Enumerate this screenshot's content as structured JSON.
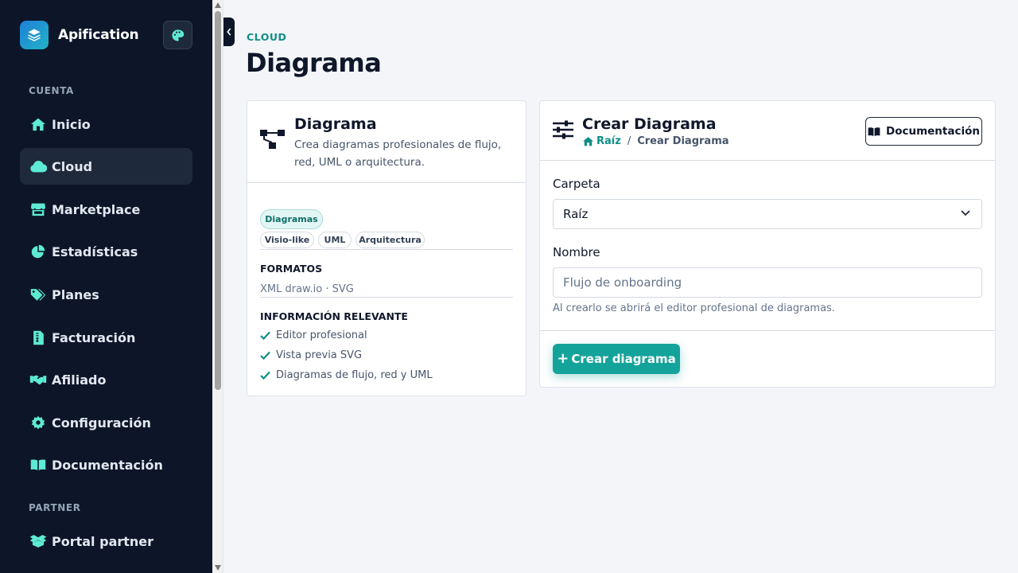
{
  "app": {
    "name": "Apification"
  },
  "sidebar": {
    "sections": {
      "cuenta": "CUENTA",
      "partner": "PARTNER"
    },
    "items": [
      {
        "label": "Inicio",
        "icon": "home-icon"
      },
      {
        "label": "Cloud",
        "icon": "cloud-icon",
        "active": true
      },
      {
        "label": "Marketplace",
        "icon": "store-icon"
      },
      {
        "label": "Estadísticas",
        "icon": "pie-chart-icon"
      },
      {
        "label": "Planes",
        "icon": "tags-icon"
      },
      {
        "label": "Facturación",
        "icon": "invoice-icon"
      },
      {
        "label": "Afiliado",
        "icon": "handshake-icon"
      },
      {
        "label": "Configuración",
        "icon": "gear-icon"
      },
      {
        "label": "Documentación",
        "icon": "book-icon"
      }
    ],
    "partner_items": [
      {
        "label": "Portal partner",
        "icon": "box-open-icon"
      }
    ]
  },
  "header": {
    "eyebrow": "CLOUD",
    "title": "Diagrama"
  },
  "info_card": {
    "title": "Diagrama",
    "description": "Crea diagramas profesionales de flujo, red, UML o arquitectura.",
    "tags": [
      "Diagramas",
      "Visio-like",
      "UML",
      "Arquitectura"
    ],
    "formats_title": "FORMATOS",
    "formats_text": "XML draw.io · SVG",
    "info_title": "INFORMACIÓN RELEVANTE",
    "info_items": [
      "Editor profesional",
      "Vista previa SVG",
      "Diagramas de flujo, red y UML"
    ]
  },
  "form_card": {
    "title": "Crear Diagrama",
    "breadcrumb": {
      "home": "Raíz",
      "separator": "/",
      "current": "Crear Diagrama"
    },
    "doc_button": "Documentación",
    "folder_label": "Carpeta",
    "folder_value": "Raíz",
    "name_label": "Nombre",
    "name_placeholder": "Flujo de onboarding",
    "help_text": "Al crearlo se abrirá el editor profesional de diagramas.",
    "submit_label": "Crear diagrama"
  },
  "colors": {
    "accent": "#14a39a",
    "sidebar_bg": "#0c1628",
    "icon": "#5eead4"
  }
}
